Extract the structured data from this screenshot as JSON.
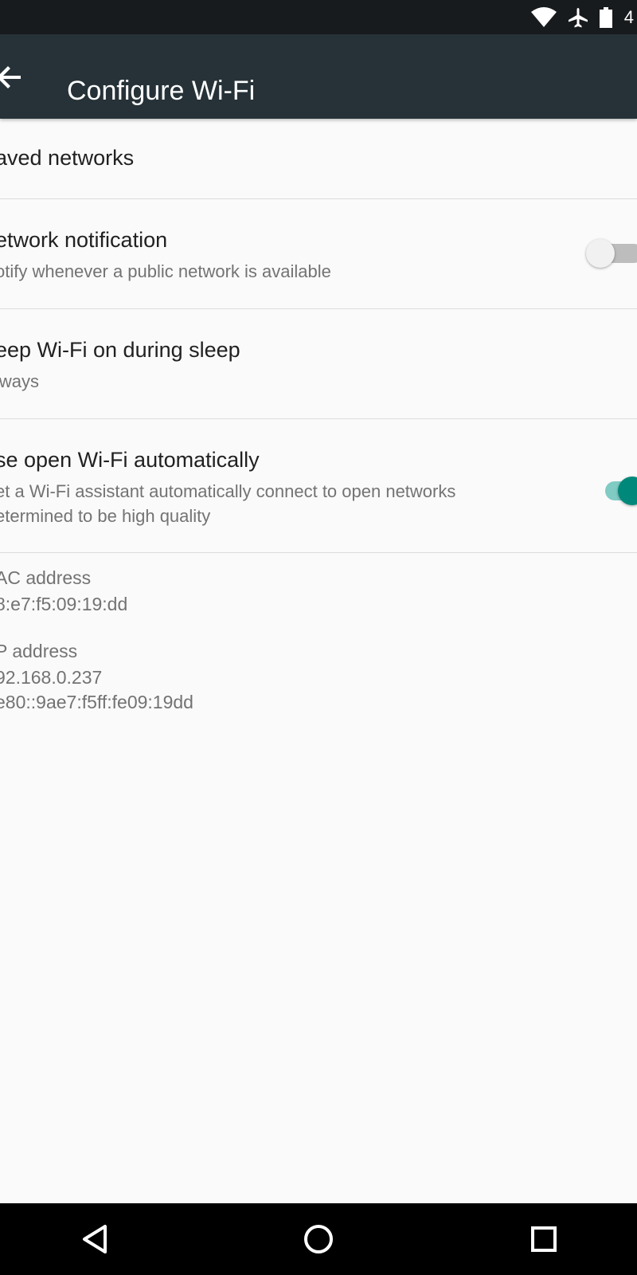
{
  "status_bar": {
    "icons": [
      "wifi-icon",
      "airplane-mode-icon",
      "battery-icon"
    ],
    "battery_text": "4"
  },
  "toolbar": {
    "back_icon": "arrow-back-icon",
    "title": "Configure Wi-Fi"
  },
  "settings": {
    "saved_networks": {
      "title": "aved networks"
    },
    "network_notification": {
      "title": "etwork notification",
      "summary": "otify whenever a public network is available",
      "enabled": false
    },
    "keep_wifi_on": {
      "title": "eep Wi-Fi on during sleep",
      "summary": "lways"
    },
    "open_wifi": {
      "title": "se open Wi-Fi automatically",
      "summary_line1": "et a Wi-Fi assistant automatically connect to open networks",
      "summary_line2": "etermined to be high quality",
      "enabled": true
    }
  },
  "info": {
    "mac_label": "AC address",
    "mac_value": "8:e7:f5:09:19:dd",
    "ip_label": "P address",
    "ip_value_1": "92.168.0.237",
    "ip_value_2": "e80::9ae7:f5ff:fe09:19dd"
  },
  "nav_bar": {
    "icons": [
      "back-triangle-icon",
      "home-circle-icon",
      "recents-square-icon"
    ]
  },
  "colors": {
    "toolbar": "#263238",
    "status_bar": "#181b1e",
    "accent": "#00897b",
    "background": "#fafafa"
  }
}
